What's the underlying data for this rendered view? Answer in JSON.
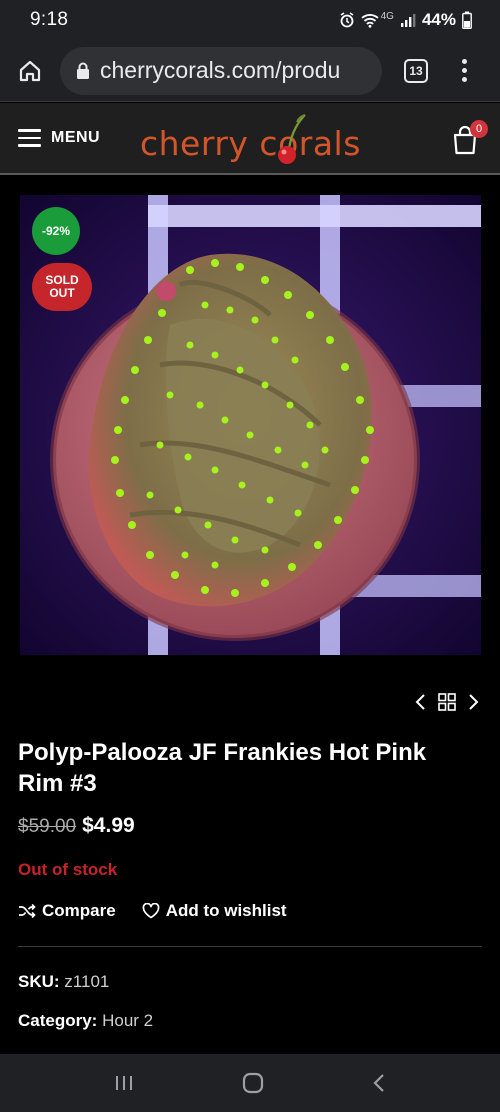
{
  "status": {
    "time": "9:18",
    "network": "4G",
    "battery": "44%"
  },
  "browser": {
    "url": "cherrycorals.com/produ",
    "tab_count": "13"
  },
  "site": {
    "menu_label": "MENU",
    "logo_text": "cherry corals",
    "cart_count": "0"
  },
  "product": {
    "discount_badge": "-92%",
    "sold_out_badge": "SOLD OUT",
    "title": "Polyp-Palooza JF Frankies Hot Pink Rim #3",
    "price_old": "$59.00",
    "price_new": "$4.99",
    "stock_status": "Out of stock",
    "compare_label": "Compare",
    "wishlist_label": "Add to wishlist",
    "sku_label": "SKU:",
    "sku_value": "z1101",
    "category_label": "Category:",
    "category_value": "Hour 2"
  },
  "icons": {
    "home": "home-icon",
    "lock": "lock-icon",
    "menu": "kebab-menu-icon",
    "cart": "cart-icon",
    "compare": "shuffle-icon",
    "wishlist": "heart-icon",
    "prev": "chevron-left-icon",
    "grid": "grid-icon",
    "next": "chevron-right-icon"
  },
  "colors": {
    "discount": "#1a9c3a",
    "sold_out": "#c5262c",
    "stock": "#c8222a",
    "logo": "#d2562a"
  }
}
